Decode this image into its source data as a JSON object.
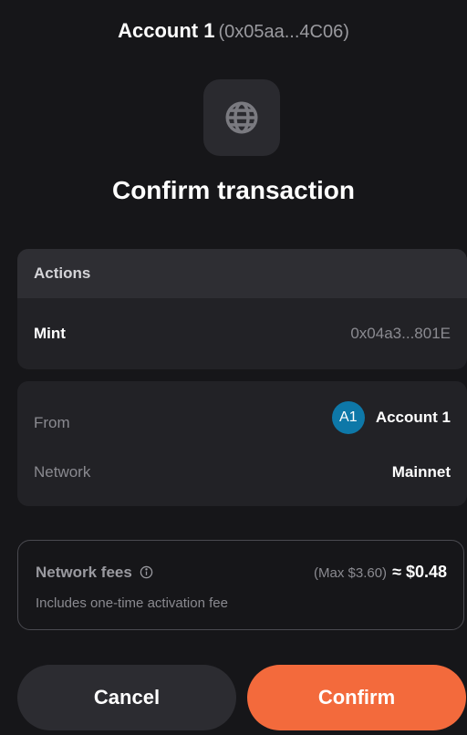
{
  "header": {
    "account_name": "Account 1",
    "account_address": "(0x05aa...4C06)"
  },
  "site_icon": "globe-icon",
  "title": "Confirm transaction",
  "actions": {
    "heading": "Actions",
    "items": [
      {
        "label": "Mint",
        "value": "0x04a3...801E"
      }
    ]
  },
  "details": {
    "from_label": "From",
    "from_avatar": "A1",
    "from_account": "Account 1",
    "network_label": "Network",
    "network_value": "Mainnet"
  },
  "fees": {
    "label": "Network fees",
    "max": "(Max $3.60)",
    "approx": "≈ $0.48",
    "note": "Includes one-time activation fee"
  },
  "buttons": {
    "cancel": "Cancel",
    "confirm": "Confirm"
  },
  "colors": {
    "background": "#161619",
    "accent": "#f36a3c",
    "avatar": "#0e78a8"
  }
}
